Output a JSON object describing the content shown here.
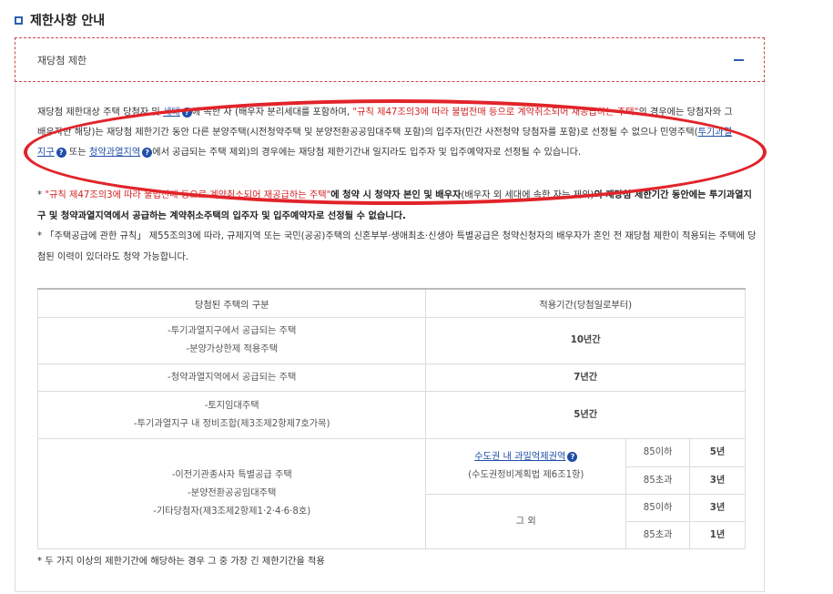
{
  "section": {
    "title": "제한사항 안내"
  },
  "accordion": {
    "header": "재당첨 제한",
    "toggle_symbol": "–"
  },
  "para1": {
    "t1": "재당첨 제한대상 주택 당첨자 및 ",
    "link_household": "세대",
    "t2": "에 속한 자 (배우자 분리세대를 포함하며, ",
    "red1": "\"규칙 제47조의3에 따라 불법전매 등으로 계약취소되어 재공급하는 주택\"",
    "t3": "의 경우에는 당첨자와 그 배우자만 해당)는 재당첨 제한기간 동안 다른 분양주택(시전청약주택 및 분양전환공공임대주택 포함)의 입주자(민간 사전청약 당첨자를 포함)로 선정될 수 없으나 민영주택(",
    "link_overheat": "투기과열지구",
    "t4": " 또는 ",
    "link_adjust": "청약과열지역",
    "t5": "에서 공급되는 주택 제외)의 경우에는 재당첨 제한기간내 일지라도 입주자 및 입주예약자로 선정될 수 있습니다."
  },
  "note1": {
    "bullet": "*",
    "red": "\"규칙 제47조의3에 따라 불법전매 등으로 계약취소되어 재공급하는 주택\"",
    "b1": "에 청약 시 청약자 본인 및 배우자",
    "t1": "(배우자 외 세대에 속한 자는 제외)",
    "b2": "의 재당첨 제한기간 동안에는 투기과열지구 및 청약과열지역에서 공급하는 계약취소주택의 입주자 및 입주예약자로 선정될 수 없습니다."
  },
  "note2": {
    "bullet": "*",
    "text": "「주택공급에 관한 규칙」 제55조의3에 따라, 규제지역 또는 국민(공공)주택의 신혼부부·생애최초·신생아 특별공급은 청약신청자의 배우자가 혼인 전 재당첨 제한이 적용되는 주택에 당첨된 이력이 있더라도 청약 가능합니다."
  },
  "table": {
    "headers": [
      "당첨된 주택의 구분",
      "적용기간(당첨일로부터)"
    ],
    "r1": {
      "lines": [
        "-투기과열지구에서 공급되는 주택",
        "-분양가상한제 적용주택"
      ],
      "period": "10년간"
    },
    "r2": {
      "lines": [
        "-청약과열지역에서 공급되는 주택"
      ],
      "period": "7년간"
    },
    "r3": {
      "lines": [
        "-토지임대주택",
        "-투기과열지구 내 정비조합(제3조제2항제7호가목)"
      ],
      "period": "5년간"
    },
    "r4": {
      "lines": [
        "-이전기관종사자 특별공급 주택",
        "-분양전환공공임대주택",
        "-기타당첨자(제3조제2항제1·2·4·6·8호)"
      ],
      "metro_link": "수도권 내 과밀억제권역",
      "metro_sub": "(수도권정비계획법 제6조1항)",
      "other": "그 외",
      "sizes": [
        "85이하",
        "85초과",
        "85이하",
        "85초과"
      ],
      "years": [
        "5년",
        "3년",
        "3년",
        "1년"
      ]
    }
  },
  "footnote": "* 두 가지 이상의 제한기간에 해당하는 경우 그 중 가장 긴 제한기간을 적용"
}
